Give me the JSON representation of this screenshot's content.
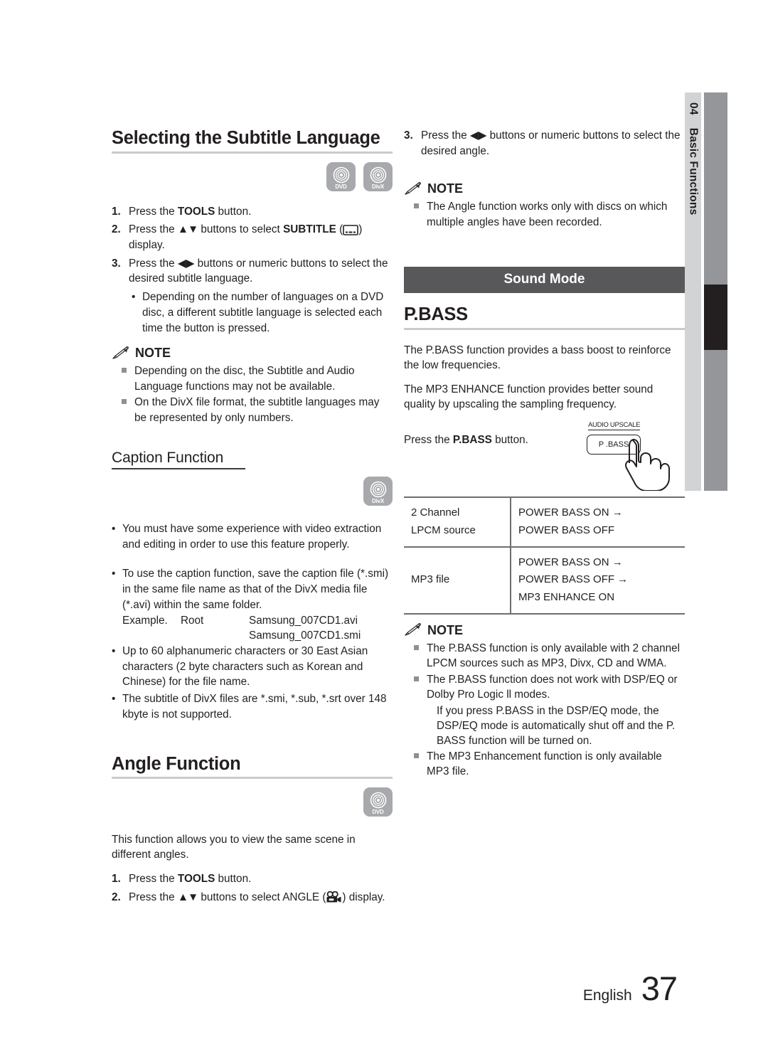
{
  "chapter_tab": {
    "number": "04",
    "title": "Basic Functions"
  },
  "footer": {
    "language": "English",
    "page": "37"
  },
  "left_column": {
    "section_title": "Selecting the Subtitle Language",
    "badges": [
      {
        "icon": "disc-icon",
        "label": "DVD"
      },
      {
        "icon": "disc-icon",
        "label": "DivX"
      }
    ],
    "steps": [
      {
        "num": "1.",
        "pre": "Press the ",
        "bold": "TOOLS",
        "post": " button."
      },
      {
        "num": "2.",
        "pre": "Press the ▲▼ buttons to select ",
        "bold": "SUBTITLE",
        "post": " ( ) display."
      },
      {
        "num": "3.",
        "pre": "Press the ◀▶ buttons or numeric buttons to select the desired subtitle language.",
        "bold": "",
        "post": ""
      }
    ],
    "step3_bullet": "Depending on the number of languages on a DVD disc, a different subtitle language is selected each time the button is pressed.",
    "note_label": "NOTE",
    "notes": [
      "Depending on the disc, the Subtitle and Audio Language functions may not be available.",
      "On the DivX file format, the subtitle languages may be represented by only numbers."
    ],
    "caption_heading": "Caption Function",
    "caption_badge": {
      "icon": "disc-icon",
      "label": "DivX"
    },
    "caption_bullets": [
      "You must have some experience with video extraction and editing in order to use this feature properly.",
      "To use the caption function, save the caption file (*.smi) in the same file name as that of the DivX media file (*.avi) within the same folder.",
      "Up to 60 alphanumeric characters or 30 East Asian characters (2 byte characters such as Korean and Chinese) for the file name.",
      "The subtitle of DivX files are *.smi, *.sub, *.srt over 148 kbyte is not supported."
    ],
    "example": {
      "label": "Example.",
      "root": "Root",
      "file1": "Samsung_007CD1.avi",
      "file2": "Samsung_007CD1.smi"
    },
    "angle_heading": "Angle Function",
    "angle_badge": {
      "icon": "disc-icon",
      "label": "DVD"
    },
    "angle_intro": "This function allows you to view the same scene in different angles.",
    "angle_steps": [
      {
        "num": "1.",
        "pre": "Press the ",
        "bold": "TOOLS",
        "post": " button."
      },
      {
        "num": "2.",
        "pre": "Press the ▲▼ buttons to select ANGLE ( ) display.",
        "bold": "",
        "post": ""
      }
    ]
  },
  "right_column": {
    "step3": {
      "num": "3.",
      "text": "Press the ◀▶ buttons or numeric buttons to select the desired angle."
    },
    "note_label": "NOTE",
    "angle_note": "The Angle function works only with discs on which multiple angles have been recorded.",
    "banner": "Sound Mode",
    "pbass_heading": "P.BASS",
    "pbass_paragraphs": [
      "The P.BASS function provides a bass boost to reinforce the low frequencies.",
      "The MP3 ENHANCE function provides better sound quality by upscaling the sampling frequency."
    ],
    "press_pre": "Press the ",
    "press_bold": "P.BASS",
    "press_post": " button.",
    "button_illustration": {
      "top_label": "AUDIO UPSCALE",
      "button_label": "P .BASS",
      "hand": "pointing-hand-icon"
    },
    "table": {
      "rows": [
        {
          "source_line1": "2 Channel",
          "source_line2": "LPCM source",
          "modes": [
            "POWER BASS ON →",
            "POWER BASS OFF"
          ]
        },
        {
          "source_line1": "MP3 file",
          "source_line2": "",
          "modes": [
            "POWER BASS ON →",
            "POWER BASS OFF →",
            "MP3 ENHANCE ON"
          ]
        }
      ]
    },
    "notes": [
      "The P.BASS function is only available with 2 channel LPCM sources such as MP3, Divx, CD and WMA.",
      "The P.BASS function does not work with DSP/EQ or Dolby Pro Logic ll modes.",
      "The MP3 Enhancement function is only available MP3 file."
    ],
    "note2_sub": "If you press P.BASS in the DSP/EQ mode, the DSP/EQ mode is automatically shut off and the P. BASS function will be turned on."
  }
}
